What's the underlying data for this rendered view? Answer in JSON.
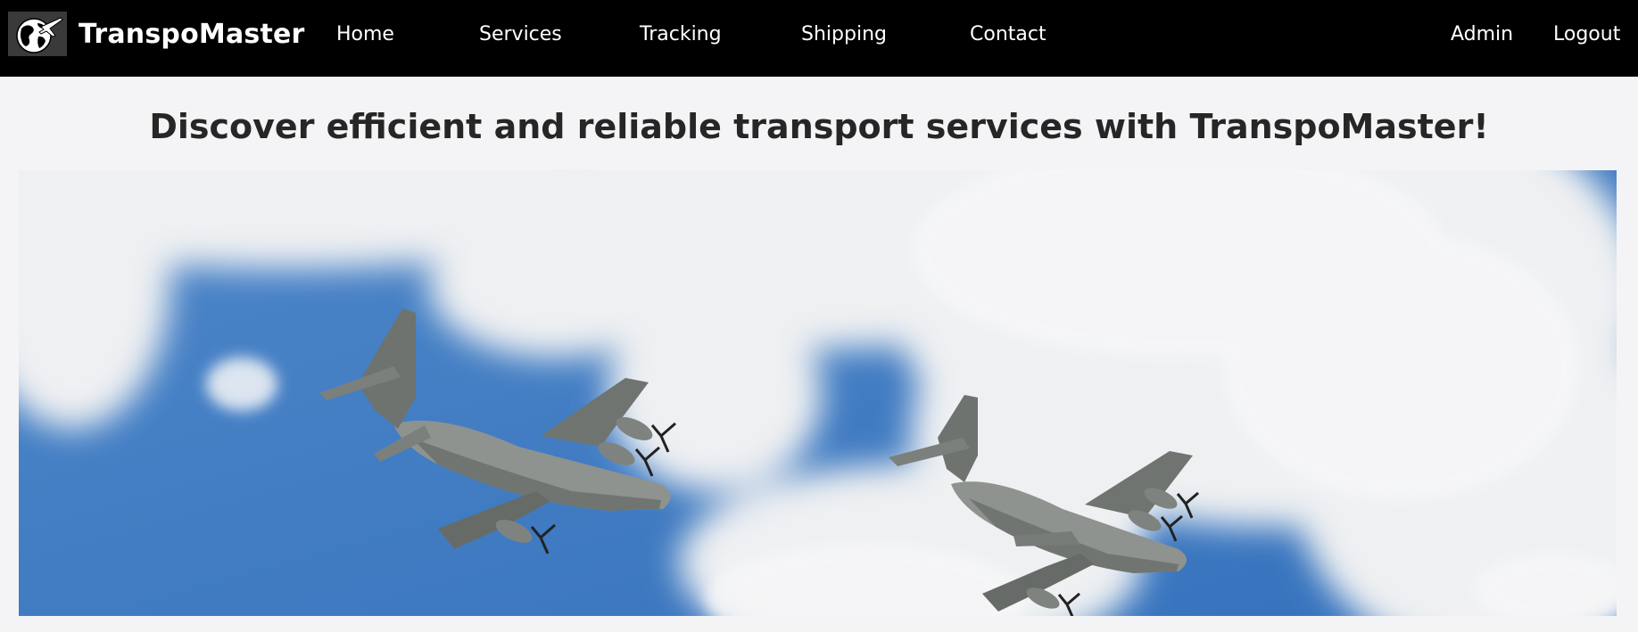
{
  "navbar": {
    "brand": "TranspoMaster",
    "logo_icon": "globe-airplane-icon",
    "links": [
      {
        "label": "Home"
      },
      {
        "label": "Services"
      },
      {
        "label": "Tracking"
      },
      {
        "label": "Shipping"
      },
      {
        "label": "Contact"
      }
    ],
    "user_links": [
      {
        "label": "Admin"
      },
      {
        "label": "Logout"
      }
    ]
  },
  "main": {
    "headline": "Discover efficient and reliable transport services with TranspoMaster!"
  },
  "hero": {
    "icon": "two-military-cargo-airplanes-in-cloudy-sky-image"
  },
  "colors": {
    "navbar_bg": "#000000",
    "page_bg": "#f4f4f6",
    "headline": "#262626",
    "sky": "#3c7bc4",
    "aircraft": "#8d928e"
  }
}
